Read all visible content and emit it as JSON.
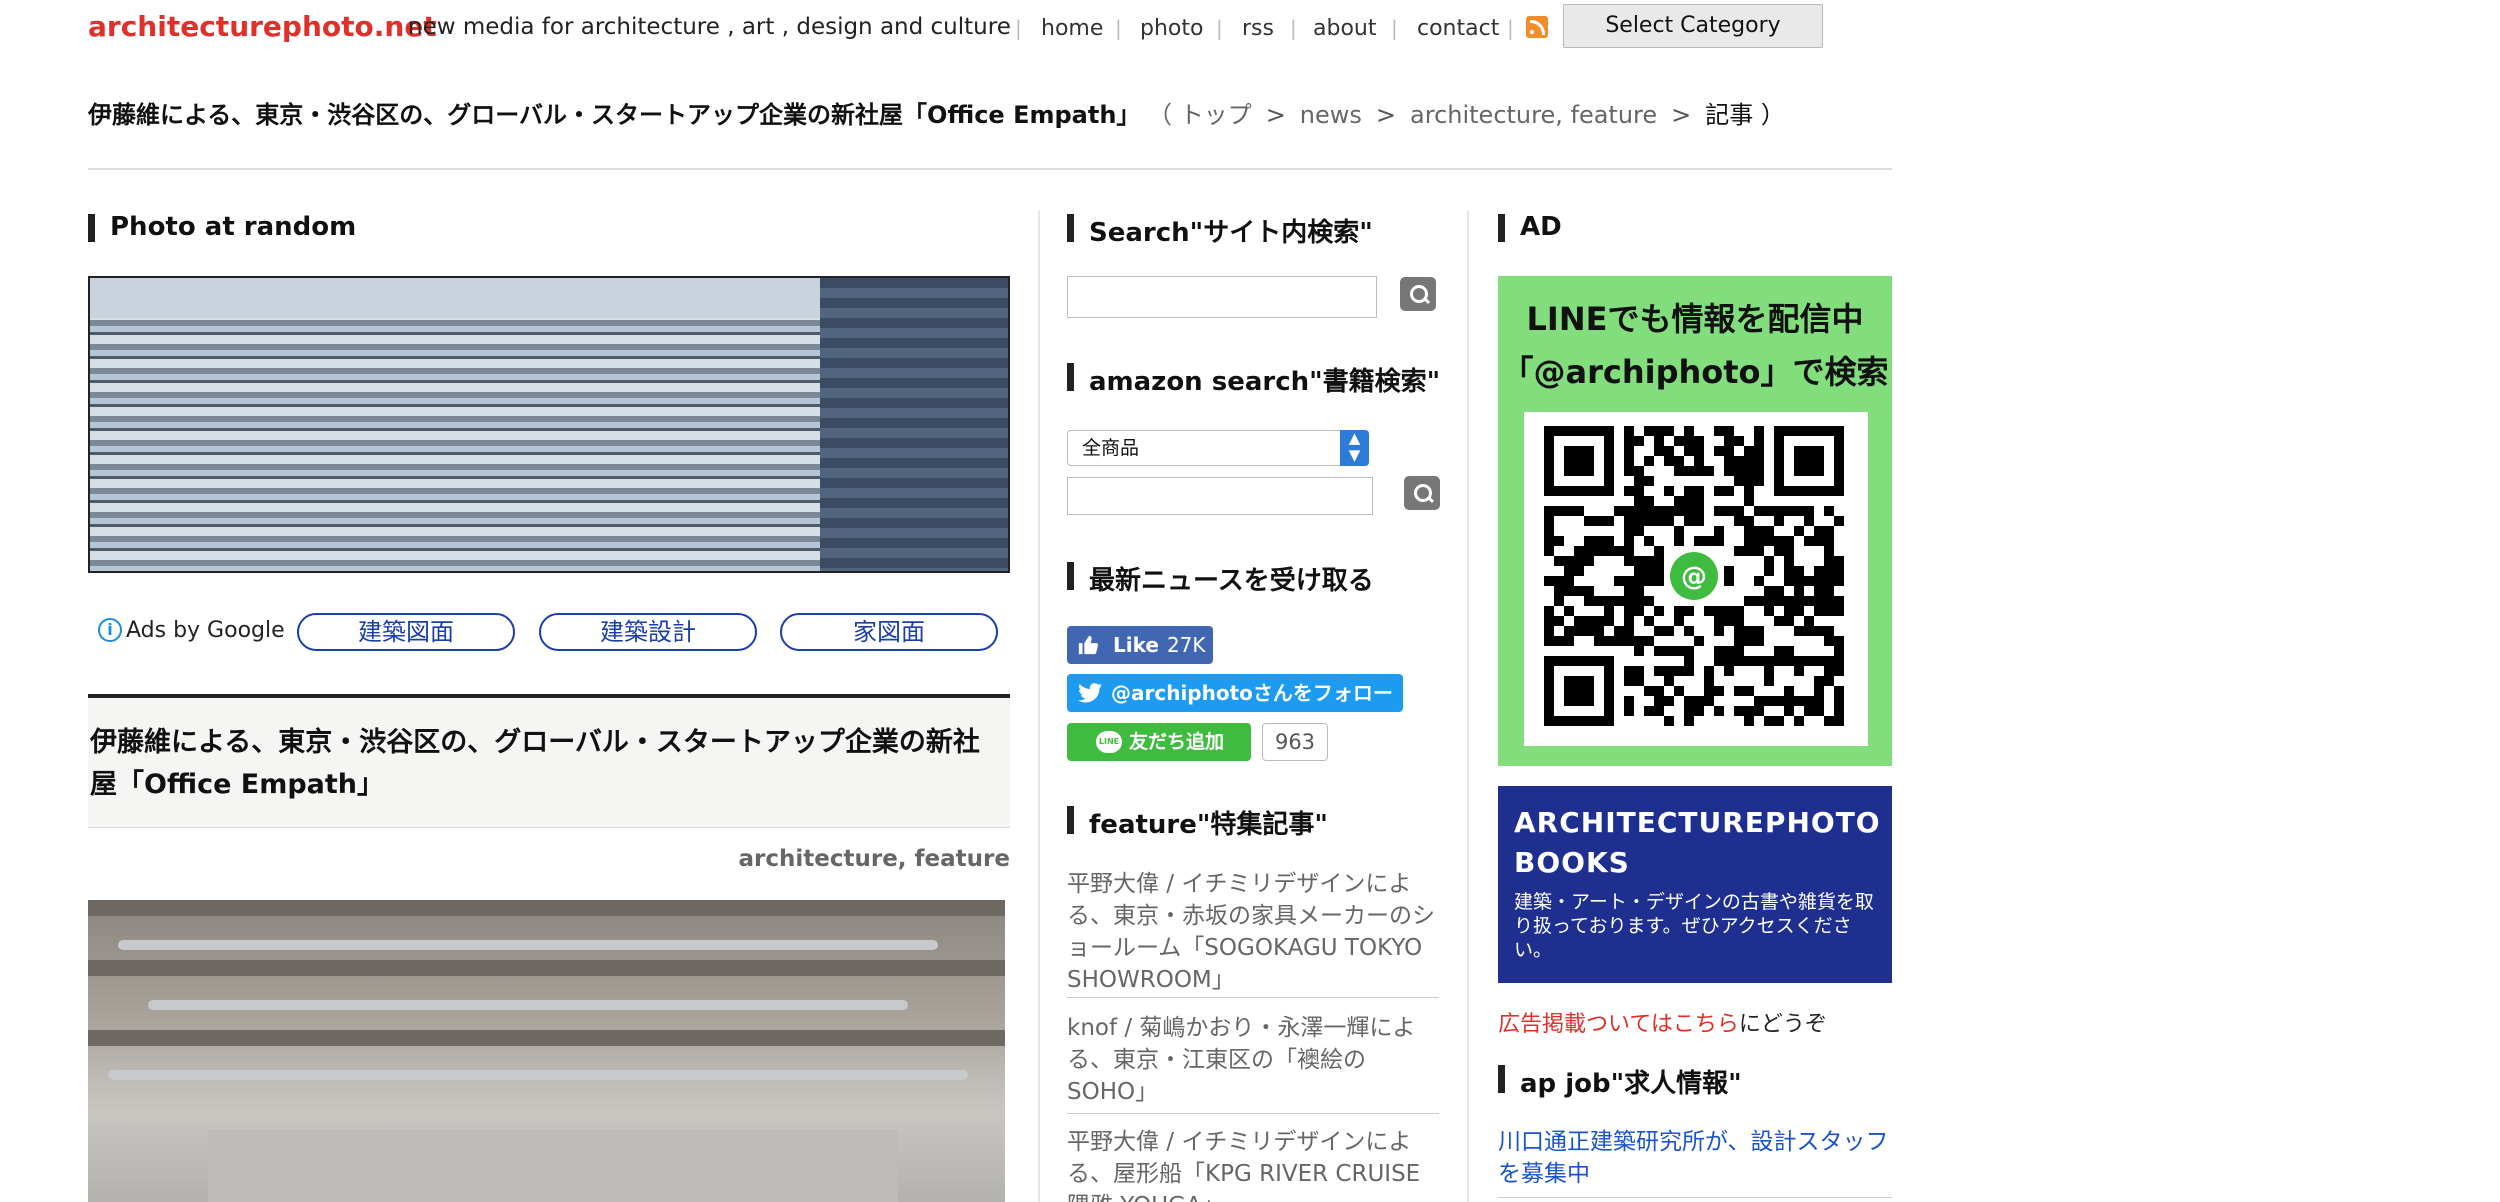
{
  "header": {
    "logo": "architecturephoto.net",
    "tagline": "new media for architecture , art , design and culture",
    "nav": [
      "home",
      "photo",
      "rss",
      "about",
      "contact"
    ],
    "select_category": "Select Category"
  },
  "breadcrumb": {
    "title": "伊藤維による、東京・渋谷区の、グローバル・スタートアップ企業の新社屋「Office Empath」",
    "open": "（",
    "items": [
      "トップ",
      "news",
      "architecture, feature",
      "記事"
    ],
    "close": "）"
  },
  "main": {
    "photo_heading": "Photo at random",
    "ads_by_google": "Ads by Google",
    "ad_links": [
      "建築図面",
      "建築設計",
      "家図面"
    ],
    "article_title": "伊藤維による、東京・渋谷区の、グローバル・スタートアップ企業の新社屋「Office Empath」",
    "article_categories": "architecture, feature"
  },
  "sidebar": {
    "search_heading": "Search\"サイト内検索\"",
    "amazon_heading": "amazon search\"書籍検索\"",
    "amazon_select": "全商品",
    "news_heading": "最新ニュースを受け取る",
    "fb_like": "Like",
    "fb_count": "27K",
    "twitter_follow": "@archiphotoさんをフォロー",
    "line_add": "友だち追加",
    "line_logo": "LINE",
    "line_count": "963",
    "feature_heading": "feature\"特集記事\"",
    "features": [
      "平野大偉 / イチミリデザインによる、東京・赤坂の家具メーカーのショールーム「SOGOKAGU TOKYO SHOWROOM」",
      "knof / 菊嶋かおり・永澤一輝による、東京・江東区の「襖絵のSOHO」",
      "平野大偉 / イチミリデザインによる、屋形船「KPG RIVER CRUISE 隅雅 YOUGA」"
    ]
  },
  "right": {
    "ad_heading": "AD",
    "line_ad_line1": "LINEでも情報を配信中",
    "line_ad_line2": "「@archiphoto」で検索",
    "books_title1": "ARCHITECTUREPHOTO",
    "books_title2": "BOOKS",
    "books_desc": "建築・アート・デザインの古書や雑貨を取り扱っております。ぜひアクセスください。",
    "ad_contact_link": "広告掲載ついてはこちら",
    "ad_contact_suffix": "にどうぞ",
    "job_heading": "ap job\"求人情報\"",
    "job_link": "川口通正建築研究所が、設計スタッフを募集中"
  },
  "colors": {
    "logo": "#e0302a",
    "facebook": "#4267b2",
    "twitter": "#1d9bf0",
    "line": "#3fbc3f",
    "books_bg": "#1e2f8f",
    "line_ad_bg": "#82dd7c"
  }
}
